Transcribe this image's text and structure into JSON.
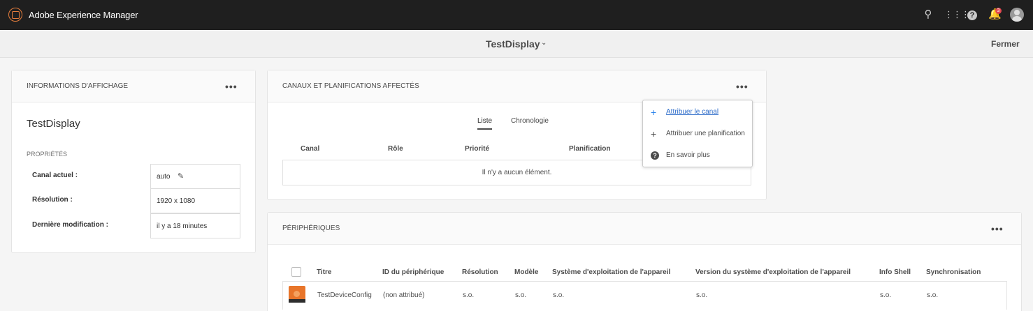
{
  "app": {
    "title": "Adobe Experience Manager",
    "notification_count": "3"
  },
  "header": {
    "page_title": "TestDisplay",
    "close_label": "Fermer"
  },
  "info_card": {
    "title": "INFORMATIONS D'AFFICHAGE",
    "more_label": "•••",
    "display_name": "TestDisplay",
    "properties_label": "PROPRIÉTÉS",
    "properties": [
      {
        "key": "Canal actuel :",
        "value": "auto"
      },
      {
        "key": "Résolution :",
        "value": "1920 x 1080"
      },
      {
        "key": "Dernière modification :",
        "value": "il y a 18 minutes"
      }
    ]
  },
  "channels_card": {
    "title": "CANAUX ET PLANIFICATIONS AFFECTÉS",
    "more_label": "•••",
    "tabs": [
      {
        "label": "Liste",
        "active": true
      },
      {
        "label": "Chronologie",
        "active": false
      }
    ],
    "columns": [
      "Canal",
      "Rôle",
      "Priorité",
      "Planification"
    ],
    "empty_message": "Il n'y a aucun élément."
  },
  "actions_popover": {
    "items": [
      {
        "icon": "plus-icon",
        "label": "Attribuer le canal"
      },
      {
        "icon": "plus-icon",
        "label": "Attribuer une planification"
      },
      {
        "icon": "help-icon",
        "label": "En savoir plus"
      }
    ]
  },
  "devices_card": {
    "title": "PÉRIPHÉRIQUES",
    "more_label": "•••",
    "columns": [
      "Titre",
      "ID du périphérique",
      "Résolution",
      "Modèle",
      "Système d'exploitation de l'appareil",
      "Version du système d'exploitation de l'appareil",
      "Info Shell",
      "Synchronisation"
    ],
    "rows": [
      {
        "title": "TestDeviceConfig",
        "device_id": "(non attribué)",
        "resolution": "s.o.",
        "model": "s.o.",
        "os": "s.o.",
        "os_version": "s.o.",
        "shell_info": "s.o.",
        "sync": "s.o."
      }
    ]
  },
  "colors": {
    "topnav_bg": "#1f1f1f",
    "brand_accent": "#e37c3c",
    "link_blue": "#2c6bc9",
    "badge_red": "#e34850",
    "device_thumb": "#e8752a"
  }
}
